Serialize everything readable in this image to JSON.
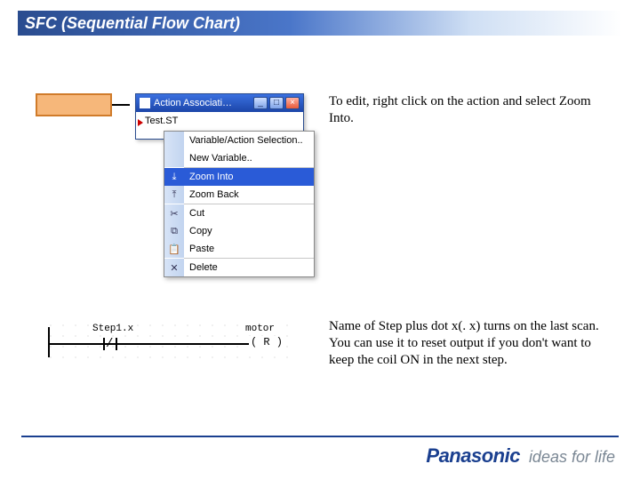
{
  "title": "SFC (Sequential Flow Chart)",
  "desc_top": "To edit, right click on the action and select Zoom Into.",
  "desc_bot": "Name of Step plus dot x(. x) turns on the last scan.   You can use it to reset output if you don't want to keep the coil ON in the next step.",
  "win": {
    "title": "Action Associati…",
    "min": "_",
    "max": "□",
    "close": "×",
    "action_item": "Test.ST"
  },
  "ctx": {
    "items": [
      {
        "label": "Variable/Action Selection..",
        "icon": ""
      },
      {
        "label": "New Variable..",
        "icon": ""
      },
      {
        "__sep": true
      },
      {
        "label": "Zoom Into",
        "icon": "⤓",
        "hover": true
      },
      {
        "label": "Zoom Back",
        "icon": "⤒"
      },
      {
        "__sep": true
      },
      {
        "label": "Cut",
        "icon": "✂"
      },
      {
        "label": "Copy",
        "icon": "⧉"
      },
      {
        "label": "Paste",
        "icon": "📋"
      },
      {
        "__sep": true
      },
      {
        "label": "Delete",
        "icon": "✕"
      }
    ]
  },
  "ladder": {
    "contact_label": "Step1.x",
    "coil_label": "motor",
    "coil_text": "( R )",
    "nc_slash": "/"
  },
  "footer": {
    "brand": "Panasonic",
    "tagline": "ideas for life"
  }
}
